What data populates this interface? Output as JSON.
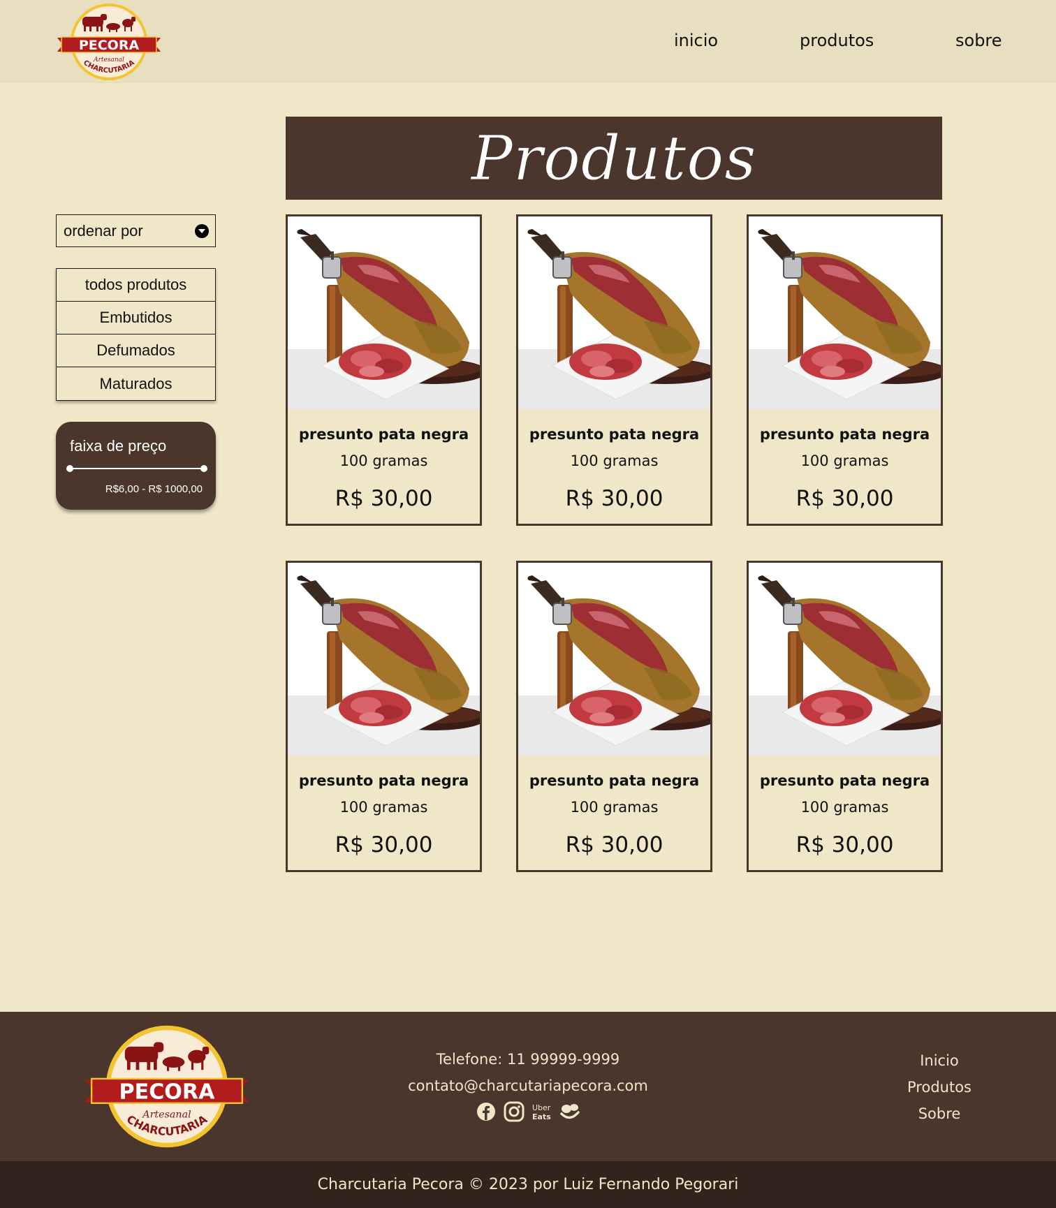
{
  "header": {
    "logo": {
      "brand": "PECORA",
      "tagline": "Artesanal",
      "subtitle": "CHARCUTARIA"
    },
    "nav": [
      "inicio",
      "produtos",
      "sobre"
    ]
  },
  "main": {
    "title": "Produtos"
  },
  "sidebar": {
    "sort": {
      "label": "ordenar por"
    },
    "categories": [
      "todos produtos",
      "Embutidos",
      "Defumados",
      "Maturados"
    ],
    "price_filter": {
      "title": "faixa de preço",
      "range": "R$6,00 - R$ 1000,00"
    }
  },
  "products": [
    {
      "name": "presunto pata negra",
      "weight": "100 gramas",
      "price": "R$ 30,00"
    },
    {
      "name": "presunto pata negra",
      "weight": "100 gramas",
      "price": "R$ 30,00"
    },
    {
      "name": "presunto pata negra",
      "weight": "100 gramas",
      "price": "R$ 30,00"
    },
    {
      "name": "presunto pata negra",
      "weight": "100 gramas",
      "price": "R$ 30,00"
    },
    {
      "name": "presunto pata negra",
      "weight": "100 gramas",
      "price": "R$ 30,00"
    },
    {
      "name": "presunto pata negra",
      "weight": "100 gramas",
      "price": "R$ 30,00"
    }
  ],
  "footer": {
    "phone": "Telefone: 11 99999-9999",
    "email": "contato@charcutariapecora.com",
    "social_icons": [
      "facebook-icon",
      "instagram-icon",
      "uber-eats-icon",
      "ifood-icon"
    ],
    "uber_eats_text": [
      "Uber",
      "Eats"
    ],
    "links": [
      "Inicio",
      "Produtos",
      "Sobre"
    ],
    "copyright": "Charcutaria Pecora © 2023 por Luiz Fernando Pegorari"
  },
  "colors": {
    "background": "#f0e6c8",
    "header": "#e8dfc0",
    "brown": "#4a362c",
    "dark_brown": "#30241d",
    "logo_red": "#a81818"
  }
}
